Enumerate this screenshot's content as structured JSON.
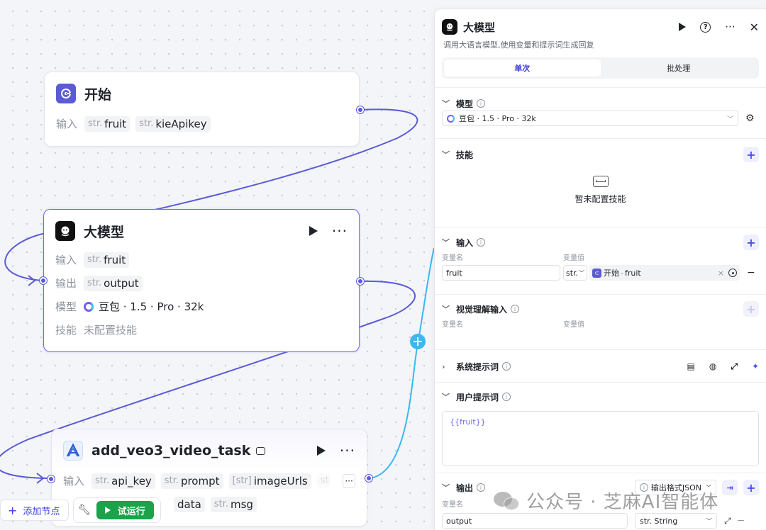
{
  "nodes": {
    "start": {
      "title": "开始",
      "input_label": "输入",
      "inputs": [
        {
          "type": "str.",
          "name": "fruit"
        },
        {
          "type": "str.",
          "name": "kieApikey"
        }
      ]
    },
    "llm": {
      "title": "大模型",
      "input_label": "输入",
      "output_label": "输出",
      "model_label": "模型",
      "skill_label": "技能",
      "input": {
        "type": "str.",
        "name": "fruit"
      },
      "output": {
        "type": "str.",
        "name": "output"
      },
      "model_value": "豆包 · 1.5 · Pro · 32k",
      "skill_value": "未配置技能"
    },
    "veo": {
      "title": "add_veo3_video_task",
      "input_label": "输入",
      "inputs": [
        {
          "type": "str.",
          "name": "api_key"
        },
        {
          "type": "str.",
          "name": "prompt"
        },
        {
          "type": "[str]",
          "name": "imageUrls"
        },
        {
          "type": "str."
        }
      ],
      "outputs": [
        {
          "name": "data"
        },
        {
          "type": "str.",
          "name": "msg"
        }
      ]
    }
  },
  "toolbar": {
    "add_node": "添加节点",
    "trial_run": "试运行"
  },
  "panel": {
    "title": "大模型",
    "description": "调用大语言模型,使用变量和提示词生成回复",
    "tabs": [
      "单次",
      "批处理"
    ],
    "model": {
      "label": "模型",
      "value": "豆包 · 1.5 · Pro · 32k"
    },
    "skills": {
      "label": "技能",
      "empty": "暂未配置技能"
    },
    "input": {
      "label": "输入",
      "col_name": "变量名",
      "col_value": "变量值",
      "var_name": "fruit",
      "var_type": "str.",
      "ref_node": "开始",
      "ref_sep": "-",
      "ref_var": "fruit"
    },
    "visual": {
      "label": "视觉理解输入",
      "col_name": "变量名",
      "col_value": "变量值"
    },
    "system_prompt": {
      "label": "系统提示词"
    },
    "user_prompt": {
      "label": "用户提示词",
      "value": "{{fruit}}"
    },
    "output": {
      "label": "输出",
      "format": "输出格式JSON",
      "col_name": "变量名",
      "var_name": "output",
      "var_type": "str. String"
    }
  },
  "watermark": "公众号 · 芝麻AI智能体",
  "colors": {
    "accent": "#5b5bd6",
    "selected_border": "#6d6af2",
    "trial_run": "#1aa34a",
    "add_circle": "#3bb8f0"
  }
}
